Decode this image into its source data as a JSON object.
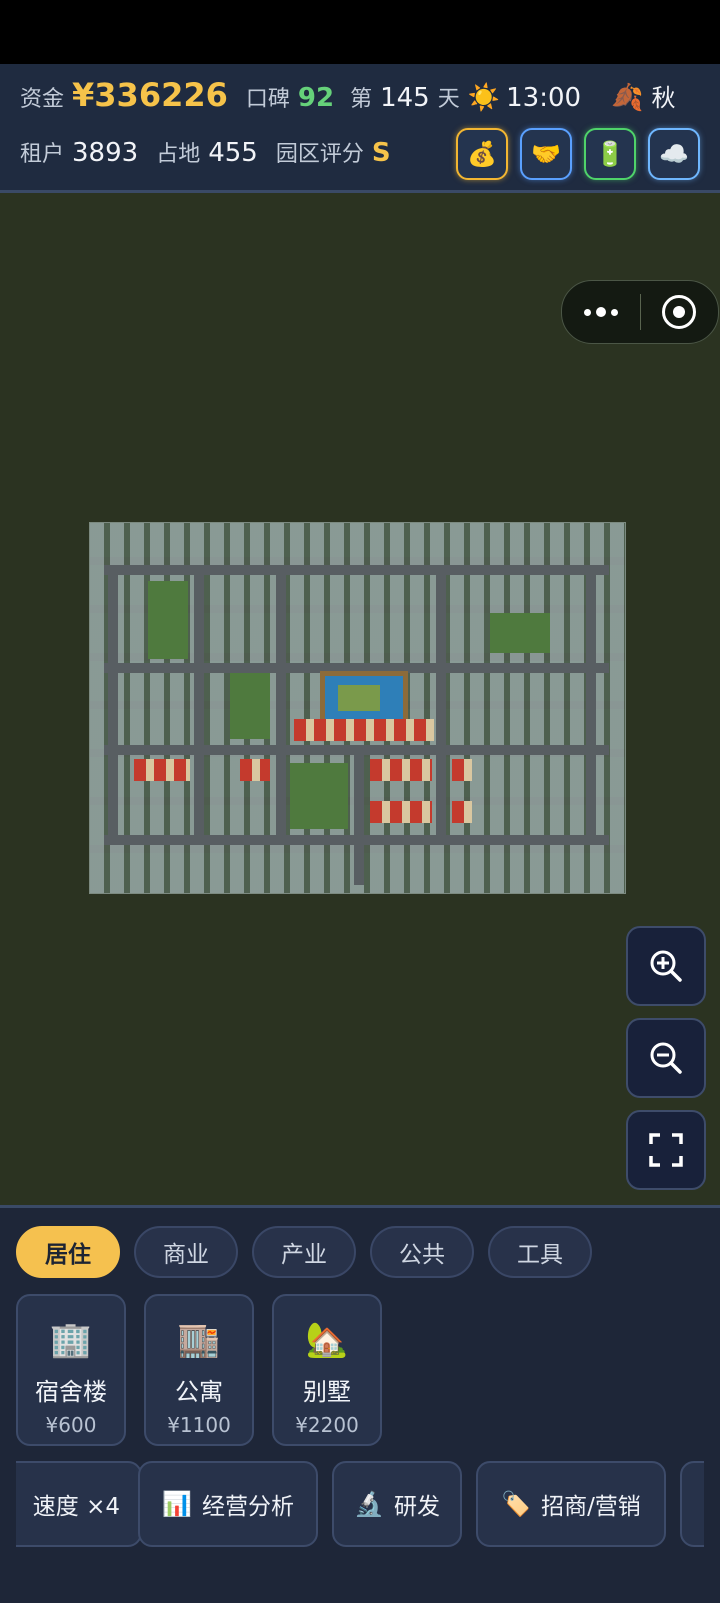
{
  "hud": {
    "funds_label": "资金",
    "funds_value": "¥336226",
    "reputation_label": "口碑",
    "reputation_value": "92",
    "day_prefix": "第",
    "day_value": "145",
    "day_suffix": "天",
    "time": "13:00",
    "season": "秋",
    "tenants_label": "租户",
    "tenants_value": "3893",
    "land_label": "占地",
    "land_value": "455",
    "rating_label": "园区评分",
    "rating_value": "S",
    "buttons": [
      {
        "icon": "money-bag-icon",
        "glyph": "💰",
        "accent": "#f2b632"
      },
      {
        "icon": "handshake-icon",
        "glyph": "🤝",
        "accent": "#5aa0ff"
      },
      {
        "icon": "battery-icon",
        "glyph": "🔋",
        "accent": "#4fd36a"
      },
      {
        "icon": "cloud-icon",
        "glyph": "☁️",
        "accent": "#6fb7ff"
      }
    ]
  },
  "weather_icon": "☀️",
  "season_icon": "🍂",
  "map_controls": [
    {
      "name": "zoom-in-icon"
    },
    {
      "name": "zoom-out-icon"
    },
    {
      "name": "fullscreen-icon"
    }
  ],
  "tabs": [
    "居住",
    "商业",
    "产业",
    "公共",
    "工具"
  ],
  "active_tab": "居住",
  "buildings": [
    {
      "name": "宿舍楼",
      "price": "¥600",
      "icon": "dormitory-icon",
      "glyph": "🏢"
    },
    {
      "name": "公寓",
      "price": "¥1100",
      "icon": "apartment-icon",
      "glyph": "🏬"
    },
    {
      "name": "别墅",
      "price": "¥2200",
      "icon": "villa-icon",
      "glyph": "🏡"
    }
  ],
  "actions": [
    {
      "label": "速度 ×4",
      "icon": ""
    },
    {
      "label": "经营分析",
      "icon": "📊"
    },
    {
      "label": "研发",
      "icon": "🔬"
    },
    {
      "label": "招商/营销",
      "icon": "🏷️"
    }
  ]
}
